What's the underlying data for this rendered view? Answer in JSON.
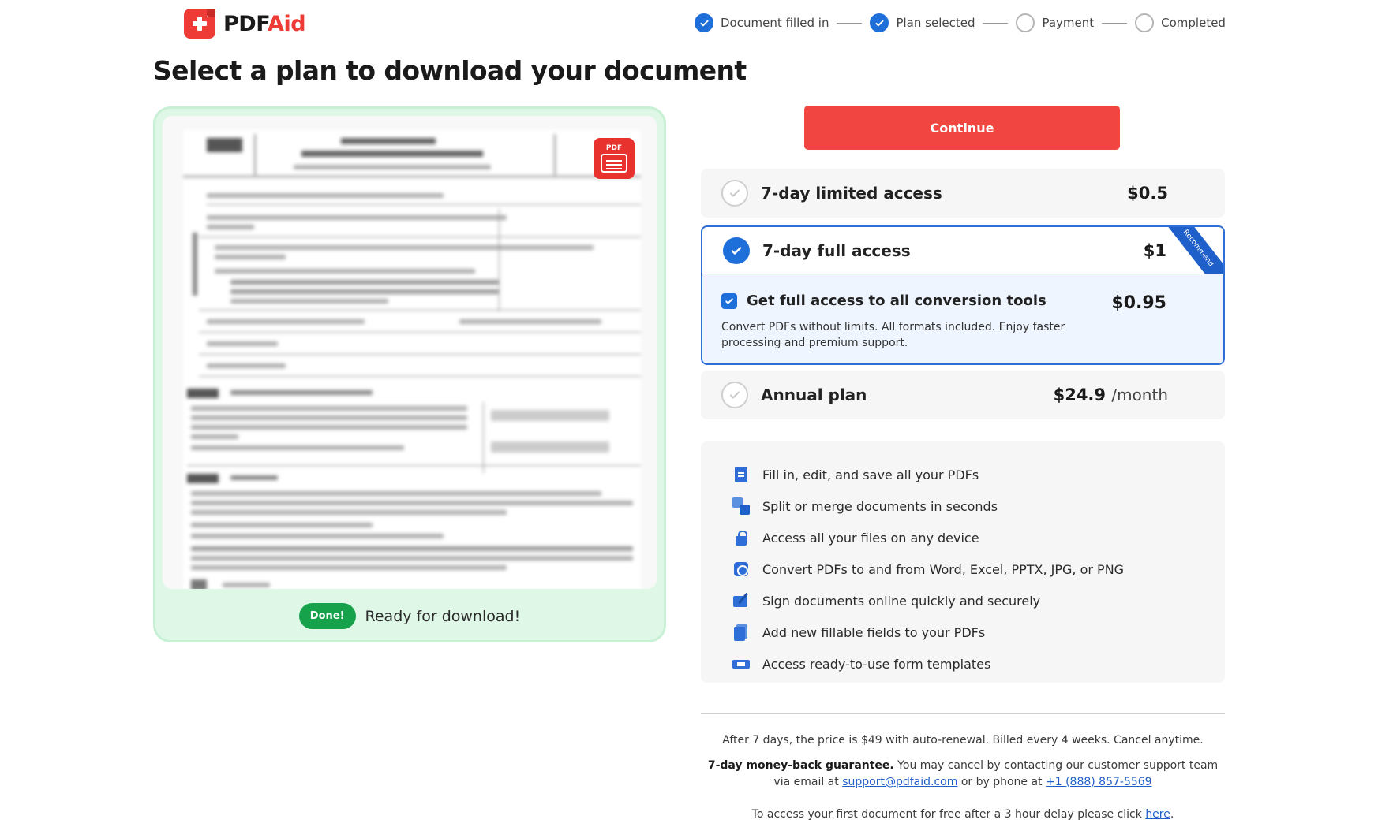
{
  "brand": {
    "name_part1": "PDF",
    "name_part2": "Aid"
  },
  "stepper": {
    "steps": [
      {
        "label": "Document filled in",
        "state": "done"
      },
      {
        "label": "Plan selected",
        "state": "done"
      },
      {
        "label": "Payment",
        "state": "pending"
      },
      {
        "label": "Completed",
        "state": "pending"
      }
    ]
  },
  "page_title": "Select a plan to download your document",
  "preview": {
    "badge_label": "PDF",
    "done_label": "Done!",
    "ready_text": "Ready for download!"
  },
  "continue_label": "Continue",
  "plans": {
    "limited": {
      "name": "7-day limited access",
      "price": "$0.5",
      "selected": false
    },
    "full": {
      "name": "7-day full access",
      "price": "$1",
      "selected": true,
      "ribbon": "Recommend",
      "addon": {
        "title": "Get full access to all conversion tools",
        "price": "$0.95",
        "checked": true,
        "description": "Convert PDFs without limits. All formats included. Enjoy faster processing and premium support."
      }
    },
    "annual": {
      "name": "Annual plan",
      "price": "$24.9",
      "unit": "/month",
      "selected": false
    }
  },
  "features": [
    {
      "icon": "edit-document-icon",
      "text": "Fill in, edit, and save all your PDFs"
    },
    {
      "icon": "split-merge-icon",
      "text": "Split or merge documents in seconds"
    },
    {
      "icon": "lock-icon",
      "text": "Access all your files on any device"
    },
    {
      "icon": "convert-icon",
      "text": "Convert PDFs to and from Word, Excel, PPTX, JPG, or PNG"
    },
    {
      "icon": "signature-icon",
      "text": "Sign documents online quickly and securely"
    },
    {
      "icon": "fillable-fields-icon",
      "text": "Add new fillable fields to your PDFs"
    },
    {
      "icon": "form-templates-icon",
      "text": "Access ready-to-use form templates"
    }
  ],
  "fine_print": {
    "renewal": "After 7 days, the price is $49 with auto-renewal. Billed every 4 weeks. Cancel anytime.",
    "guarantee_bold": "7-day money-back guarantee.",
    "guarantee_text": " You may cancel by contacting our customer support team via email at ",
    "email": "support@pdfaid.com",
    "phone_prefix": " or by phone at ",
    "phone": "+1 (888) 857-5569",
    "free_text": "To access your first document for free after a 3 hour delay please click ",
    "free_link": "here",
    "free_end": "."
  },
  "colors": {
    "accent_red": "#f04540",
    "accent_blue": "#1e6fd9",
    "success_green": "#15a24a",
    "preview_bg": "#dff7e7"
  }
}
